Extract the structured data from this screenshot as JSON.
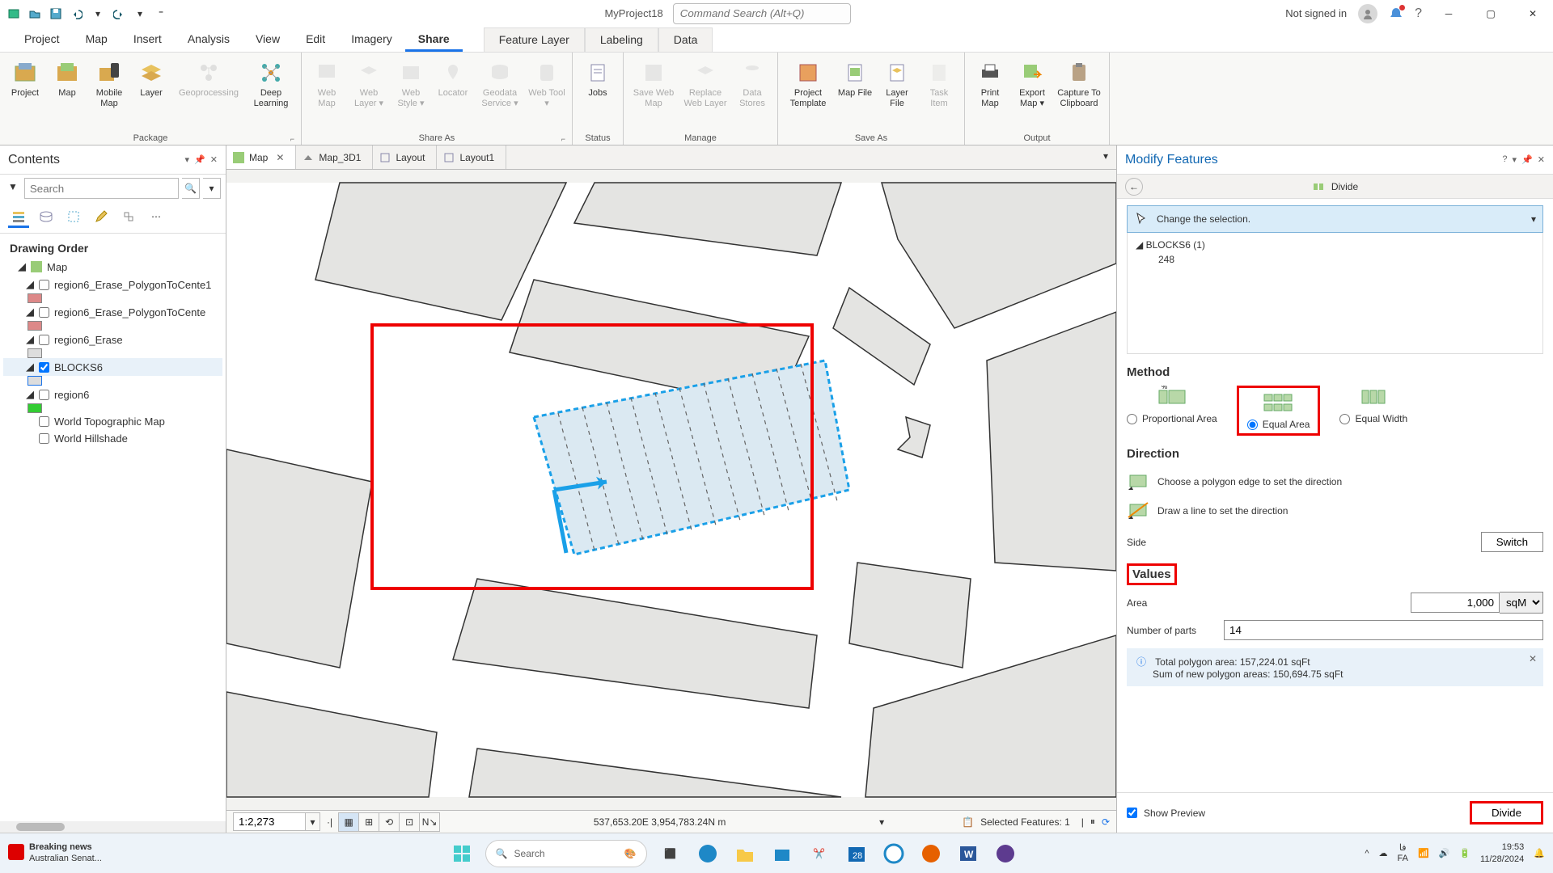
{
  "titlebar": {
    "project_name": "MyProject18",
    "command_search_placeholder": "Command Search (Alt+Q)",
    "not_signed_in": "Not signed in"
  },
  "menu": {
    "tabs": [
      "Project",
      "Map",
      "Insert",
      "Analysis",
      "View",
      "Edit",
      "Imagery",
      "Share"
    ],
    "active": "Share",
    "context_tabs": [
      "Feature Layer",
      "Labeling",
      "Data"
    ]
  },
  "ribbon": {
    "groups": [
      {
        "label": "Package",
        "items": [
          {
            "label": "Project"
          },
          {
            "label": "Map"
          },
          {
            "label": "Mobile Map"
          },
          {
            "label": "Layer"
          },
          {
            "label": "Geoprocessing",
            "disabled": true
          },
          {
            "label": "Deep Learning"
          }
        ]
      },
      {
        "label": "Share As",
        "items": [
          {
            "label": "Web Map",
            "disabled": true
          },
          {
            "label": "Web Layer ▾",
            "disabled": true
          },
          {
            "label": "Web Style ▾",
            "disabled": true
          },
          {
            "label": "Locator",
            "disabled": true
          },
          {
            "label": "Geodata Service ▾",
            "disabled": true
          },
          {
            "label": "Web Tool ▾",
            "disabled": true
          }
        ]
      },
      {
        "label": "Status",
        "items": [
          {
            "label": "Jobs"
          }
        ]
      },
      {
        "label": "Manage",
        "items": [
          {
            "label": "Save Web Map",
            "disabled": true
          },
          {
            "label": "Replace Web Layer",
            "disabled": true
          },
          {
            "label": "Data Stores",
            "disabled": true
          }
        ]
      },
      {
        "label": "Save As",
        "items": [
          {
            "label": "Project Template"
          },
          {
            "label": "Map File"
          },
          {
            "label": "Layer File"
          },
          {
            "label": "Task Item",
            "disabled": true
          }
        ]
      },
      {
        "label": "Output",
        "items": [
          {
            "label": "Print Map"
          },
          {
            "label": "Export Map ▾"
          },
          {
            "label": "Capture To Clipboard"
          }
        ]
      }
    ]
  },
  "contents": {
    "title": "Contents",
    "search_placeholder": "Search",
    "heading": "Drawing Order",
    "layers": {
      "map": "Map",
      "l1": "region6_Erase_PolygonToCente1",
      "l2": "region6_Erase_PolygonToCente",
      "l3": "region6_Erase",
      "l4": "BLOCKS6",
      "l5": "region6",
      "l6": "World Topographic Map",
      "l7": "World Hillshade"
    }
  },
  "views": {
    "tabs": [
      "Map",
      "Map_3D1",
      "Layout",
      "Layout1"
    ]
  },
  "status": {
    "scale": "1:2,273",
    "coords": "537,653.20E 3,954,783.24N m",
    "selected": "Selected Features: 1"
  },
  "modify": {
    "title": "Modify Features",
    "tool": "Divide",
    "change_selection": "Change the selection.",
    "layer": "BLOCKS6 (1)",
    "oid": "248",
    "method_label": "Method",
    "methods": {
      "prop": "Proportional Area",
      "equal": "Equal Area",
      "width": "Equal Width"
    },
    "direction_label": "Direction",
    "dir1": "Choose a polygon edge to set the direction",
    "dir2": "Draw a line to set the direction",
    "side_label": "Side",
    "switch": "Switch",
    "values_label": "Values",
    "area_label": "Area",
    "area_value": "1,000",
    "area_unit": "sqM",
    "parts_label": "Number of parts",
    "parts_value": "14",
    "info1": "Total polygon area: 157,224.01 sqFt",
    "info2": "Sum of new polygon areas: 150,694.75 sqFt",
    "preview": "Show Preview",
    "divide_btn": "Divide"
  },
  "taskbar": {
    "news_title": "Breaking news",
    "news_sub": "Australian Senat...",
    "search": "Search",
    "lang": "فا",
    "lang2": "FA",
    "time": "19:53",
    "date": "11/28/2024"
  }
}
